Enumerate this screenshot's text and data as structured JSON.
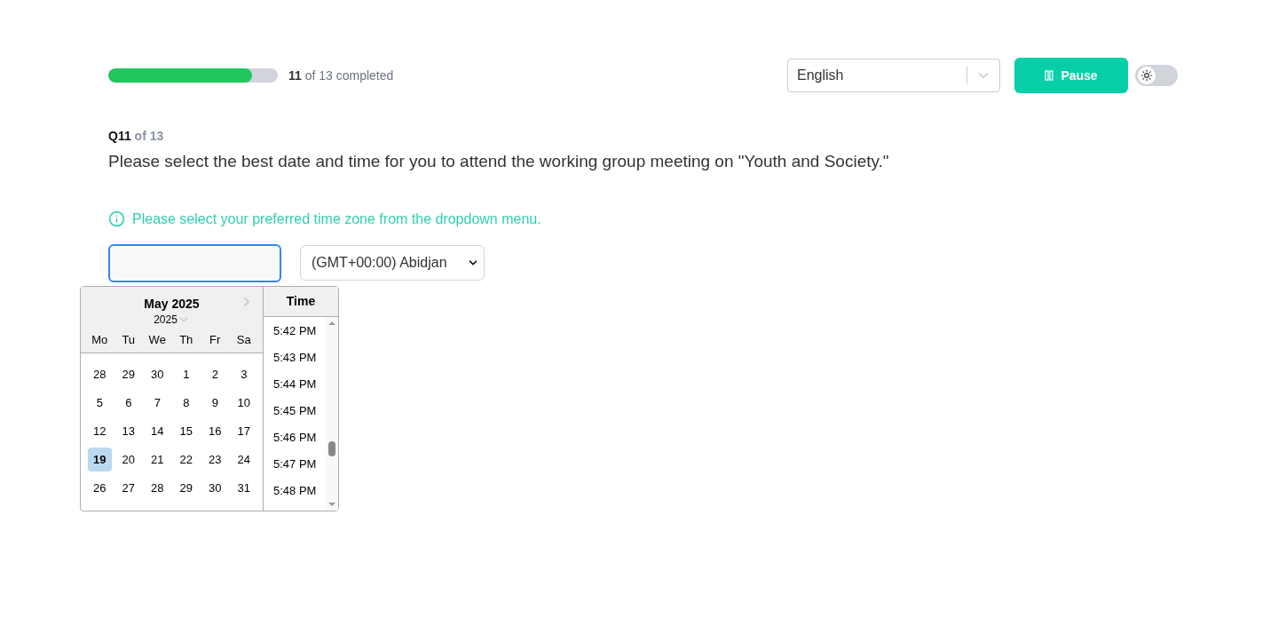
{
  "progress": {
    "level": 0.846,
    "done": "11",
    "rest": "of 13 completed"
  },
  "language": {
    "value": "English"
  },
  "pause_button": {
    "label": "Pause"
  },
  "dark_mode": {
    "on": false
  },
  "question": {
    "number": "Q11",
    "of": "of 13",
    "text": "Please select the best date and time for you to attend the working group meeting on \"Youth and Society.\""
  },
  "hint": "Please select your preferred time zone from the dropdown menu.",
  "timezone": {
    "value": "(GMT+00:00) Abidjan"
  },
  "calendar": {
    "month": "May 2025",
    "year": "2025",
    "weekdays": [
      "Mo",
      "Tu",
      "We",
      "Th",
      "Fr",
      "Sa"
    ],
    "weeks": [
      [
        {
          "day": "28",
          "selected": false
        },
        {
          "day": "29",
          "selected": false
        },
        {
          "day": "30",
          "selected": false
        },
        {
          "day": "1",
          "selected": false
        },
        {
          "day": "2",
          "selected": false
        },
        {
          "day": "3",
          "selected": false
        }
      ],
      [
        {
          "day": "5",
          "selected": false
        },
        {
          "day": "6",
          "selected": false
        },
        {
          "day": "7",
          "selected": false
        },
        {
          "day": "8",
          "selected": false
        },
        {
          "day": "9",
          "selected": false
        },
        {
          "day": "10",
          "selected": false
        }
      ],
      [
        {
          "day": "12",
          "selected": false
        },
        {
          "day": "13",
          "selected": false
        },
        {
          "day": "14",
          "selected": false
        },
        {
          "day": "15",
          "selected": false
        },
        {
          "day": "16",
          "selected": false
        },
        {
          "day": "17",
          "selected": false
        }
      ],
      [
        {
          "day": "19",
          "selected": true
        },
        {
          "day": "20",
          "selected": false
        },
        {
          "day": "21",
          "selected": false
        },
        {
          "day": "22",
          "selected": false
        },
        {
          "day": "23",
          "selected": false
        },
        {
          "day": "24",
          "selected": false
        }
      ],
      [
        {
          "day": "26",
          "selected": false
        },
        {
          "day": "27",
          "selected": false
        },
        {
          "day": "28",
          "selected": false
        },
        {
          "day": "29",
          "selected": false
        },
        {
          "day": "30",
          "selected": false
        },
        {
          "day": "31",
          "selected": false
        }
      ]
    ],
    "time_title": "Time",
    "times": [
      "5:42 PM",
      "5:43 PM",
      "5:44 PM",
      "5:45 PM",
      "5:46 PM",
      "5:47 PM",
      "5:48 PM"
    ]
  }
}
